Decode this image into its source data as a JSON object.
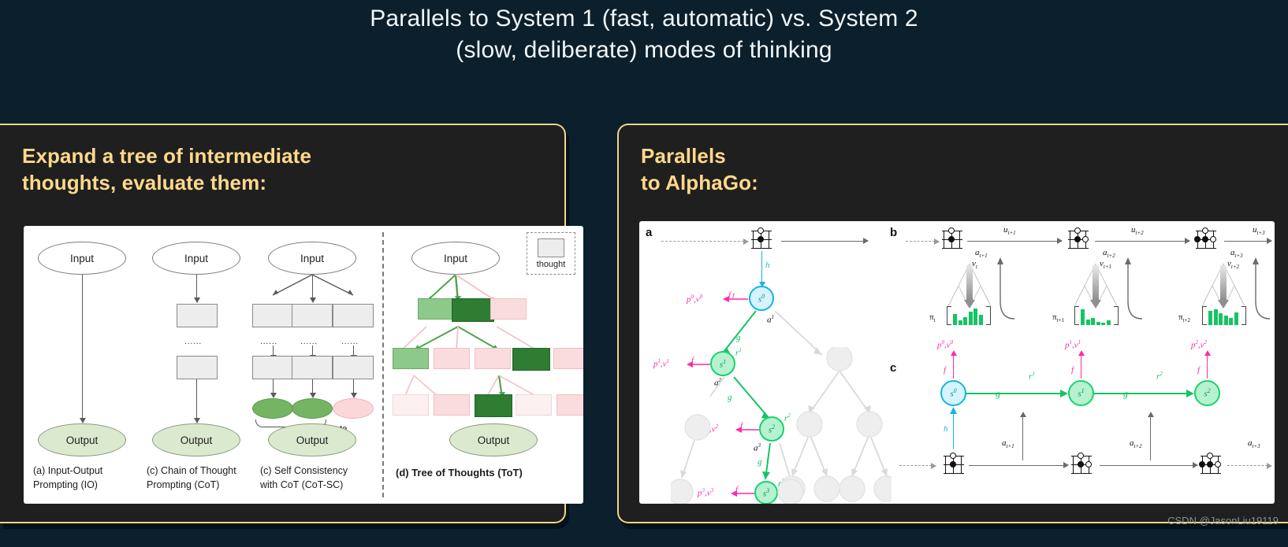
{
  "slide": {
    "title": "Parallels to System 1 (fast, automatic) vs. System 2\n(slow, deliberate) modes of thinking",
    "background_color": "#0b1f2c",
    "accent_color": "#f3d58a",
    "heading_color": "#ffd98a",
    "watermark": "CSDN @JasonLiu19119"
  },
  "left_panel": {
    "heading": "Expand a tree of intermediate\nthoughts, evaluate them:",
    "figure": {
      "name": "tree-of-thoughts-figure",
      "legend": {
        "label": "thought"
      },
      "majority_vote_label": "Majority vote",
      "dots": "......",
      "columns": [
        {
          "id": "io",
          "input_label": "Input",
          "output_label": "Output",
          "caption_line1": "(a) Input-Output",
          "caption_line2": "Prompting (IO)",
          "caption_abbrev": "IO"
        },
        {
          "id": "cot",
          "input_label": "Input",
          "output_label": "Output",
          "caption_line1": "(c) Chain of Thought",
          "caption_line2": "Prompting (CoT)",
          "caption_abbrev": "CoT"
        },
        {
          "id": "cot-sc",
          "input_label": "Input",
          "output_label": "Output",
          "caption_line1": "(c) Self Consistency",
          "caption_line2": "with CoT (CoT-SC)",
          "caption_abbrev": "CoT-SC"
        },
        {
          "id": "tot",
          "input_label": "Input",
          "output_label": "Output",
          "caption_line1": "(d) Tree of Thoughts (ToT)",
          "caption_abbrev": "ToT"
        }
      ]
    }
  },
  "right_panel": {
    "heading": "Parallels\nto AlphaGo:",
    "figure": {
      "name": "muzero-figure",
      "panels": [
        {
          "id": "a",
          "label": "a"
        },
        {
          "id": "b",
          "label": "b"
        },
        {
          "id": "c",
          "label": "c"
        }
      ],
      "panel_a": {
        "labels": {
          "h": "h",
          "f": "f",
          "g": "g",
          "state_0": "s",
          "state_0_sup": "0",
          "action_1": "a",
          "action_1_sup": "1",
          "reward_1": "r",
          "reward_1_sup": "1",
          "pv0": "p",
          "pv0_full": "p0,v0"
        },
        "nodes": [
          {
            "id": "s0",
            "text": "s",
            "sup": "0",
            "color": "cyan"
          },
          {
            "id": "s1",
            "text": "s",
            "sup": "1",
            "color": "green"
          },
          {
            "id": "s2",
            "text": "s",
            "sup": "2",
            "color": "green"
          },
          {
            "id": "s3",
            "text": "s",
            "sup": "3",
            "color": "green"
          }
        ],
        "edge_labels": [
          "a1",
          "a2",
          "a3"
        ],
        "reward_labels": [
          "r1",
          "r2",
          "r3"
        ],
        "pv_labels": [
          "p0,v0",
          "p1,v1",
          "p2,v2",
          "p3,v3"
        ],
        "function_labels": [
          "h",
          "f",
          "g"
        ]
      },
      "panel_b": {
        "observation_labels": [
          "u",
          "u",
          "u"
        ],
        "observation_subs": [
          "t+1",
          "t+2",
          "t+3"
        ],
        "action_labels": [
          "a",
          "a",
          "a"
        ],
        "action_subs": [
          "t+1",
          "t+2",
          "t+3"
        ],
        "value_labels": [
          "v",
          "v",
          "v"
        ],
        "value_subs": [
          "t",
          "t+1",
          "t+2"
        ],
        "policy_labels": [
          "π",
          "π",
          "π"
        ],
        "policy_subs": [
          "t",
          "t+1",
          "t+2"
        ],
        "policy_bars": [
          [
            14,
            6,
            10,
            17,
            21,
            13
          ],
          [
            20,
            7,
            9,
            4,
            3,
            6
          ],
          [
            18,
            20,
            15,
            12,
            9,
            16
          ]
        ]
      },
      "panel_c": {
        "states": [
          {
            "id": "s0",
            "text": "s",
            "sup": "0",
            "color": "cyan"
          },
          {
            "id": "s1",
            "text": "s",
            "sup": "1",
            "color": "green"
          },
          {
            "id": "s2",
            "text": "s",
            "sup": "2",
            "color": "green"
          }
        ],
        "pv_labels": [
          "p0,v0",
          "p1,v1",
          "p2,v2"
        ],
        "f_labels": [
          "f",
          "f",
          "f"
        ],
        "g_labels": [
          "g",
          "g"
        ],
        "r_labels": [
          "r1",
          "r2"
        ],
        "h_label": "h",
        "action_labels": [
          "a",
          "a",
          "a"
        ],
        "action_subs": [
          "t+1",
          "t+2",
          "t+3"
        ]
      }
    }
  }
}
